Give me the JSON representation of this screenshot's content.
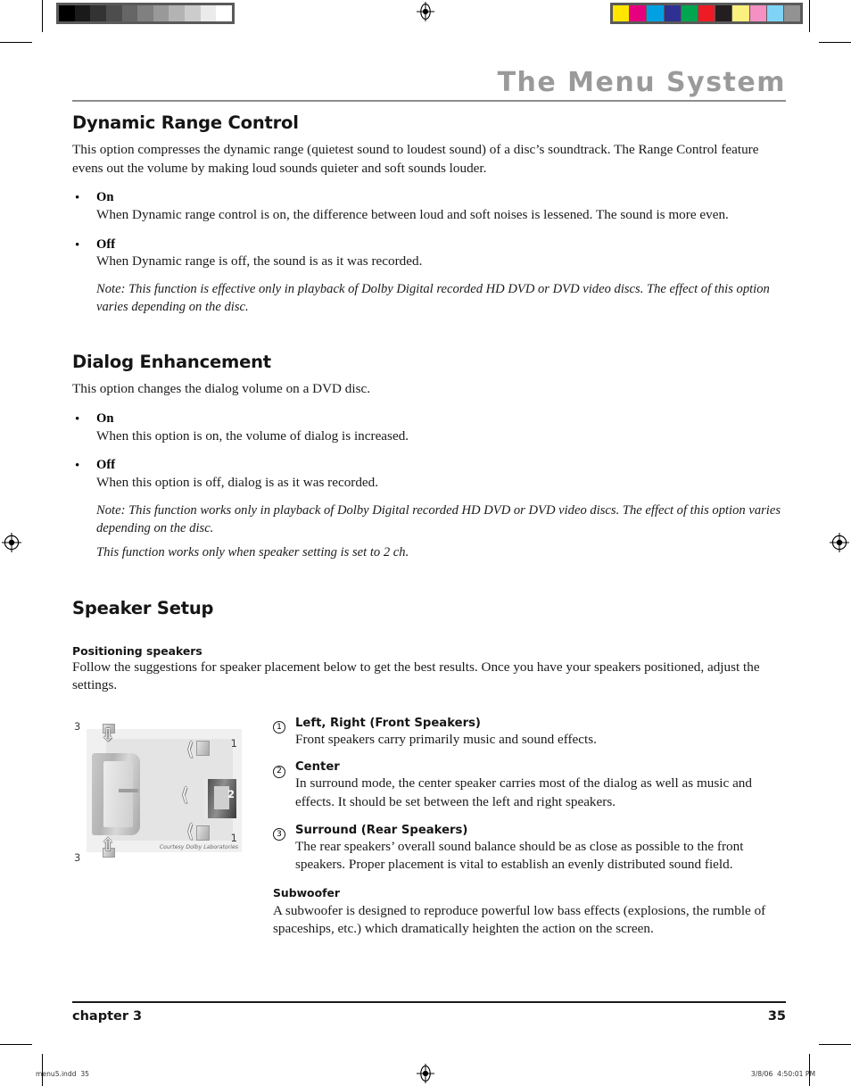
{
  "prepress": {
    "grayscale_swatches": [
      "#000000",
      "#1a1a1a",
      "#333333",
      "#4d4d4d",
      "#666666",
      "#808080",
      "#999999",
      "#b3b3b3",
      "#cccccc",
      "#ebebeb",
      "#ffffff"
    ],
    "color_swatches": [
      "#ffe500",
      "#e6007e",
      "#00a0e3",
      "#2e3191",
      "#00a54f",
      "#ed1c24",
      "#231f20",
      "#fbef7d",
      "#f590c3",
      "#7fd4f5",
      "#929292"
    ],
    "registration_icon": "registration-target-icon",
    "file_label": "menu5.indd",
    "file_page": "35",
    "date_stamp": "3/8/06",
    "time_stamp": "4:50:01 PM"
  },
  "header": {
    "title": "The Menu System"
  },
  "sections": [
    {
      "heading": "Dynamic Range Control",
      "intro": "This option compresses the dynamic range (quietest sound to loudest sound) of a disc’s soundtrack. The Range Control feature evens out the volume by making loud sounds quieter and soft sounds louder.",
      "bullet_char": "•",
      "bullets": [
        {
          "term": "On",
          "text": "When Dynamic range control is on, the difference between loud and soft noises is lessened. The sound is more even."
        },
        {
          "term": "Off",
          "text": "When Dynamic range is off, the sound is as it was recorded."
        }
      ],
      "notes": [
        "Note: This function is effective only in playback of Dolby Digital recorded HD DVD or DVD video discs. The effect of this option varies depending on the disc."
      ]
    },
    {
      "heading": "Dialog Enhancement",
      "intro": "This option changes the dialog volume on a DVD disc.",
      "bullet_char": "•",
      "bullets": [
        {
          "term": "On",
          "text": "When this option is on, the volume of dialog is increased."
        },
        {
          "term": "Off",
          "text": "When this option is off, dialog is as it was recorded."
        }
      ],
      "notes": [
        "Note: This function works only in playback of Dolby Digital recorded HD DVD or DVD video discs. The effect of this option varies depending on the disc.",
        "This function works only when speaker setting is set to 2 ch."
      ]
    }
  ],
  "speaker_setup": {
    "heading": "Speaker Setup",
    "sub_heading": "Positioning speakers",
    "intro": "Follow the suggestions for speaker placement below to get the best results. Once you have your speakers positioned, adjust the settings.",
    "diagram": {
      "courtesy": "Courtesy Dolby Laboratories",
      "labels": {
        "rear_top": "3",
        "rear_bottom": "3",
        "front_top": "1",
        "front_bottom": "1",
        "center": "2"
      }
    },
    "items": [
      {
        "number": "1",
        "title": "Left, Right (Front Speakers)",
        "text": "Front speakers carry primarily music and sound effects."
      },
      {
        "number": "2",
        "title": "Center",
        "text": "In surround mode, the center speaker carries most of the dialog as well as music and effects. It should be set between the left and right speakers."
      },
      {
        "number": "3",
        "title": "Surround (Rear Speakers)",
        "text": "The rear speakers’ overall sound balance should be as close as possible to the front speakers. Proper placement is vital to establish an evenly distributed sound field."
      }
    ],
    "subwoofer": {
      "title": "Subwoofer",
      "text": "A subwoofer is designed to reproduce powerful low bass effects (explosions, the rumble of spaceships, etc.) which dramatically heighten the action on the screen."
    }
  },
  "footer": {
    "chapter": "chapter 3",
    "page_number": "35"
  }
}
